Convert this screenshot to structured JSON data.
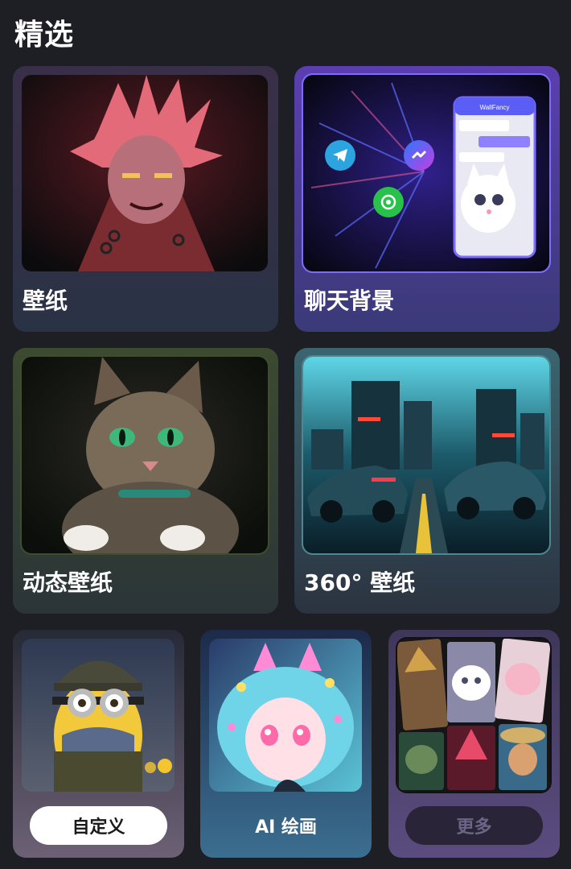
{
  "section": {
    "title": "精选"
  },
  "cards": {
    "wallpaper": {
      "label": "壁纸"
    },
    "chat_background": {
      "label": "聊天背景"
    },
    "live_wallpaper": {
      "label": "动态壁纸"
    },
    "wallpaper_360": {
      "label": "360° 壁纸"
    }
  },
  "tiles": {
    "custom": {
      "label": "自定义"
    },
    "ai_painting": {
      "label": "AI 绘画"
    },
    "more": {
      "label": "更多"
    }
  },
  "chat_preview": {
    "app_name": "WallFancy"
  },
  "icons": [
    "telegram-icon",
    "messenger-icon",
    "whatsapp-icon"
  ],
  "colors": {
    "background": "#1e1f24",
    "chat_accent": "#7b6cff",
    "custom_button_bg": "#ffffff",
    "more_button_bg": "#2a2438"
  }
}
